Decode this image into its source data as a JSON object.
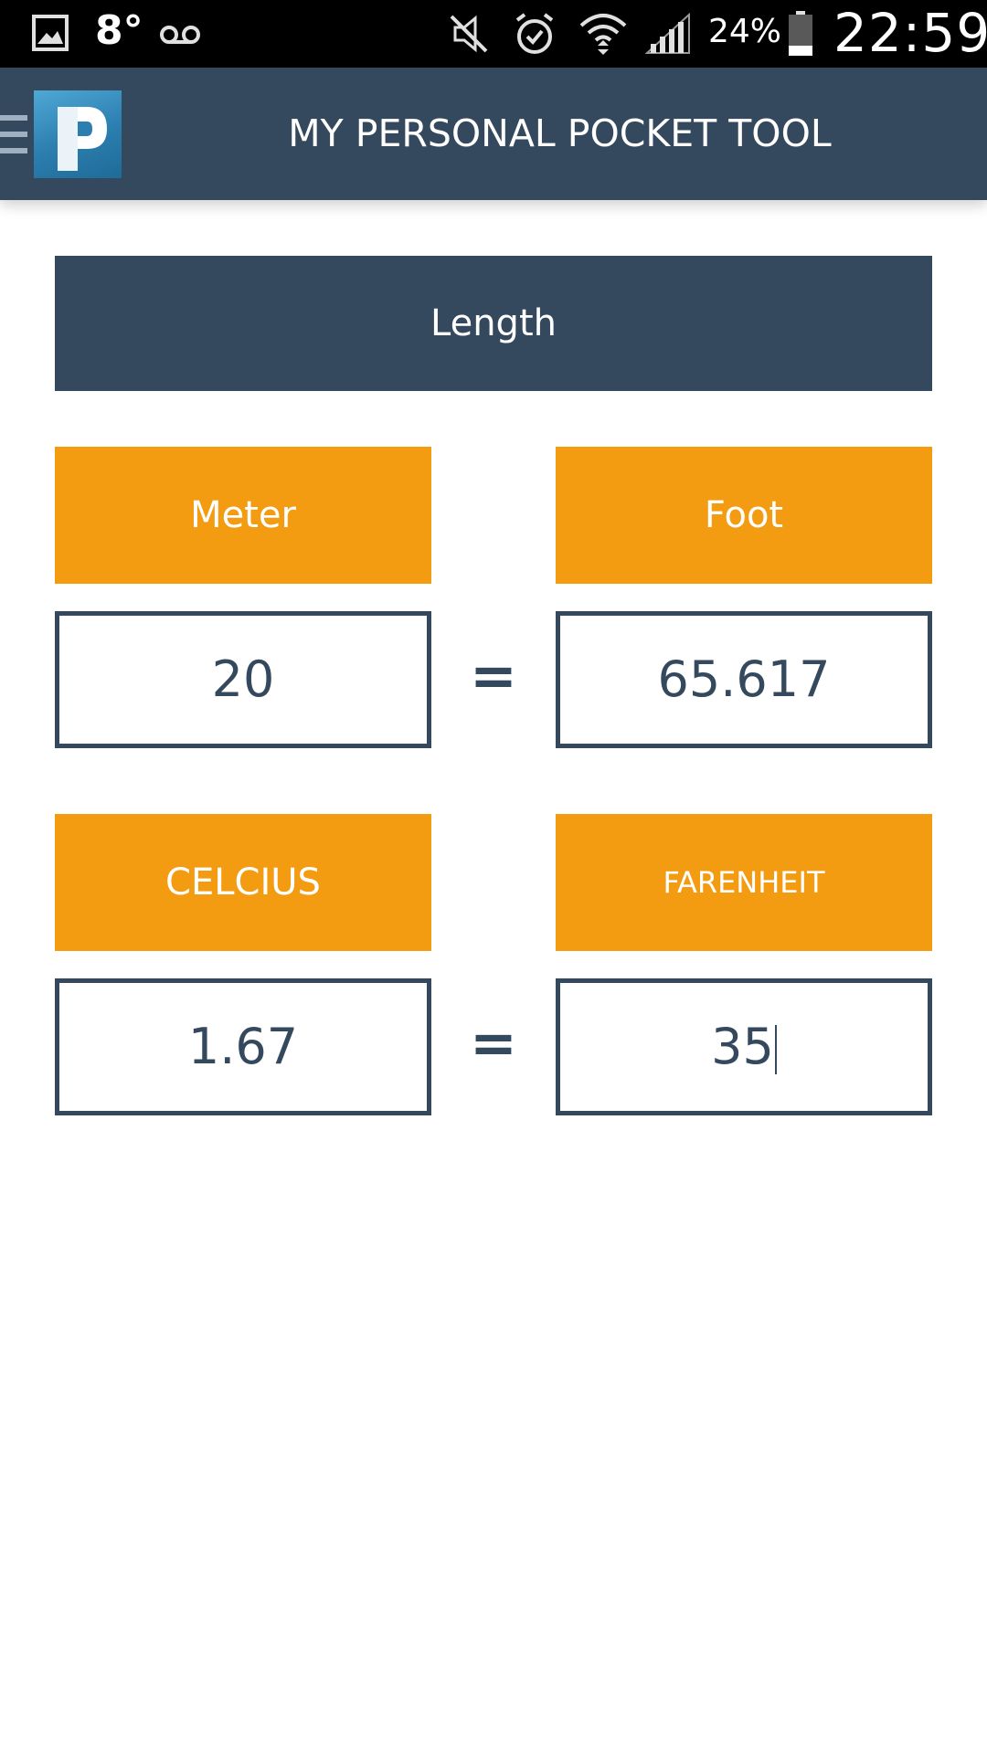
{
  "status_bar": {
    "temperature": "8°",
    "battery_percent": "24%",
    "time": "22:59",
    "icons": [
      "image-icon",
      "voicemail-icon",
      "mute-icon",
      "alarm-icon",
      "wifi-icon",
      "signal-icon",
      "battery-icon"
    ]
  },
  "app_bar": {
    "title": "MY PERSONAL POCKET TOOL",
    "menu_icon": "menu-icon",
    "logo_icon": "app-logo-icon"
  },
  "converter": {
    "category": "Length",
    "length": {
      "from_unit": "Meter",
      "to_unit": "Foot",
      "from_value": "20",
      "to_value": "65.617",
      "operator": "="
    },
    "temperature": {
      "from_unit": "CELCIUS",
      "to_unit": "FARENHEIT",
      "from_value": "1.67",
      "to_value": "35",
      "operator": "="
    }
  },
  "colors": {
    "primary": "#34495e",
    "accent": "#f39c12",
    "background": "#ffffff"
  }
}
